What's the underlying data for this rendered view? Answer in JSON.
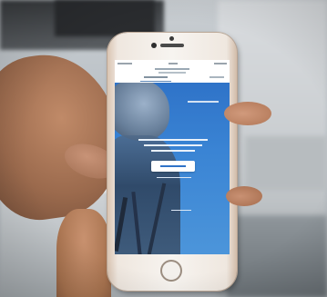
{
  "scene": {
    "subject": "hand-held-phone",
    "phone_color": "#f3ede7",
    "screen_accent": "#2f73c8"
  }
}
